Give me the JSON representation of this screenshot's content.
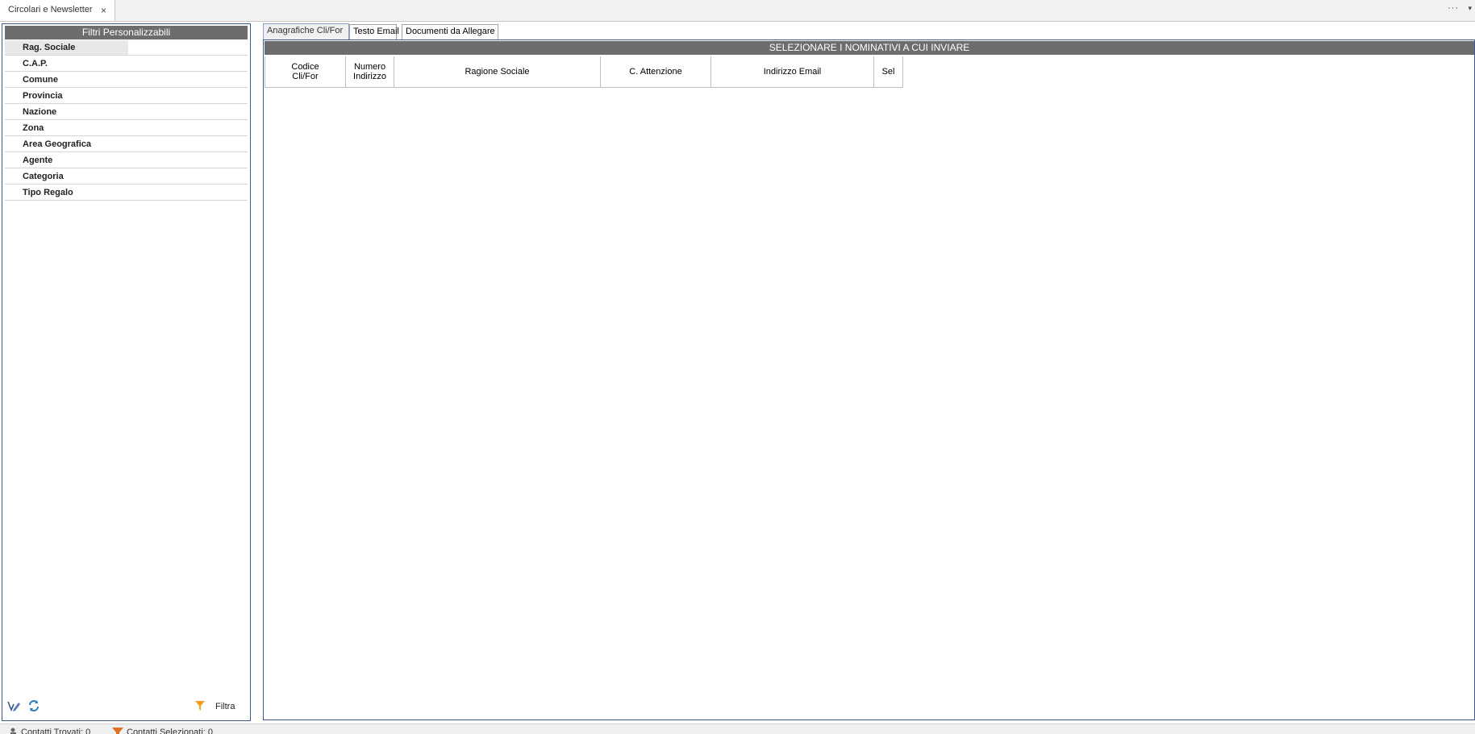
{
  "doc_tab": {
    "title": "Circolari e Newsletter",
    "close": "×"
  },
  "window_controls": {
    "more": "···",
    "dropdown": "▾"
  },
  "filters": {
    "header": "Filtri Personalizzabili",
    "items": [
      {
        "label": "Rag. Sociale",
        "value": ""
      },
      {
        "label": "C.A.P.",
        "value": ""
      },
      {
        "label": "Comune",
        "value": ""
      },
      {
        "label": "Provincia",
        "value": ""
      },
      {
        "label": "Nazione",
        "value": ""
      },
      {
        "label": "Zona",
        "value": ""
      },
      {
        "label": "Area Geografica",
        "value": ""
      },
      {
        "label": "Agente",
        "value": ""
      },
      {
        "label": "Categoria",
        "value": ""
      },
      {
        "label": "Tipo Regalo",
        "value": ""
      }
    ],
    "filter_button": "Filtra"
  },
  "main": {
    "tabs": [
      {
        "label": "Anagrafiche Cli/For"
      },
      {
        "label": "Testo Email"
      },
      {
        "label": "Documenti da Allegare"
      }
    ],
    "banner": "SELEZIONARE I NOMINATIVI A CUI INVIARE",
    "columns": [
      {
        "line1": "Codice",
        "line2": "Cli/For"
      },
      {
        "line1": "Numero",
        "line2": "Indirizzo"
      },
      {
        "line1": "Ragione Sociale",
        "line2": ""
      },
      {
        "line1": "C. Attenzione",
        "line2": ""
      },
      {
        "line1": "Indirizzo Email",
        "line2": ""
      },
      {
        "line1": "Sel",
        "line2": ""
      }
    ]
  },
  "status": {
    "found": "Contatti Trovati: 0",
    "selected": "Contatti Selezionati: 0"
  },
  "colors": {
    "header_bg": "#6d6d6d",
    "panel_border": "#3c5a8a",
    "filter_icon": "#f0a020"
  }
}
